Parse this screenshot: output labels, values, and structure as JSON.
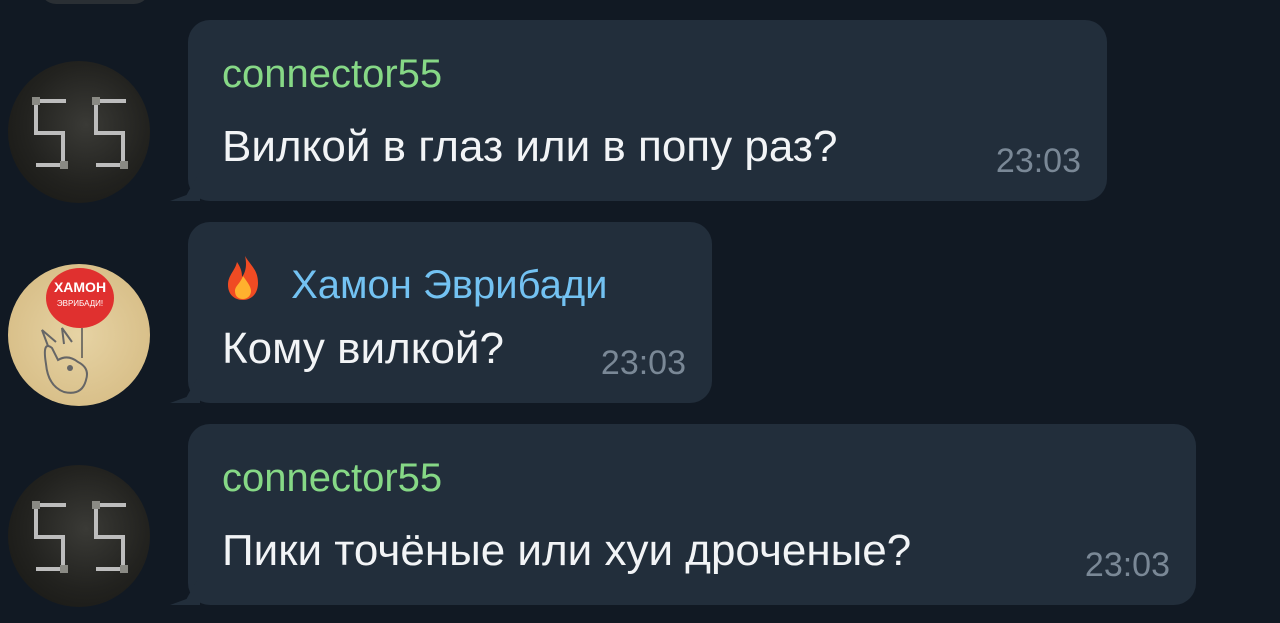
{
  "messages": [
    {
      "sender": "connector55",
      "text": "Вилкой в глаз или в попу раз?",
      "time": "23:03",
      "sender_color": "#86d886",
      "avatar": "dark-55-avatar"
    },
    {
      "sender": "Хамон Эврибади",
      "text": "Кому вилкой?",
      "time": "23:03",
      "sender_color": "#73c2f2",
      "sender_icon": "fire-icon",
      "avatar": "pig-balloon-avatar",
      "avatar_text_line1": "ХАМОН",
      "avatar_text_line2": "ЭВРИБАДИ!"
    },
    {
      "sender": "connector55",
      "text": "Пики точёные или хуи дроченые?",
      "time": "23:03",
      "sender_color": "#86d886",
      "avatar": "dark-55-avatar"
    }
  ],
  "colors": {
    "background": "#111923",
    "bubble": "#222e3b",
    "message_text": "#f2f4f6",
    "time_text": "#7a8896"
  }
}
